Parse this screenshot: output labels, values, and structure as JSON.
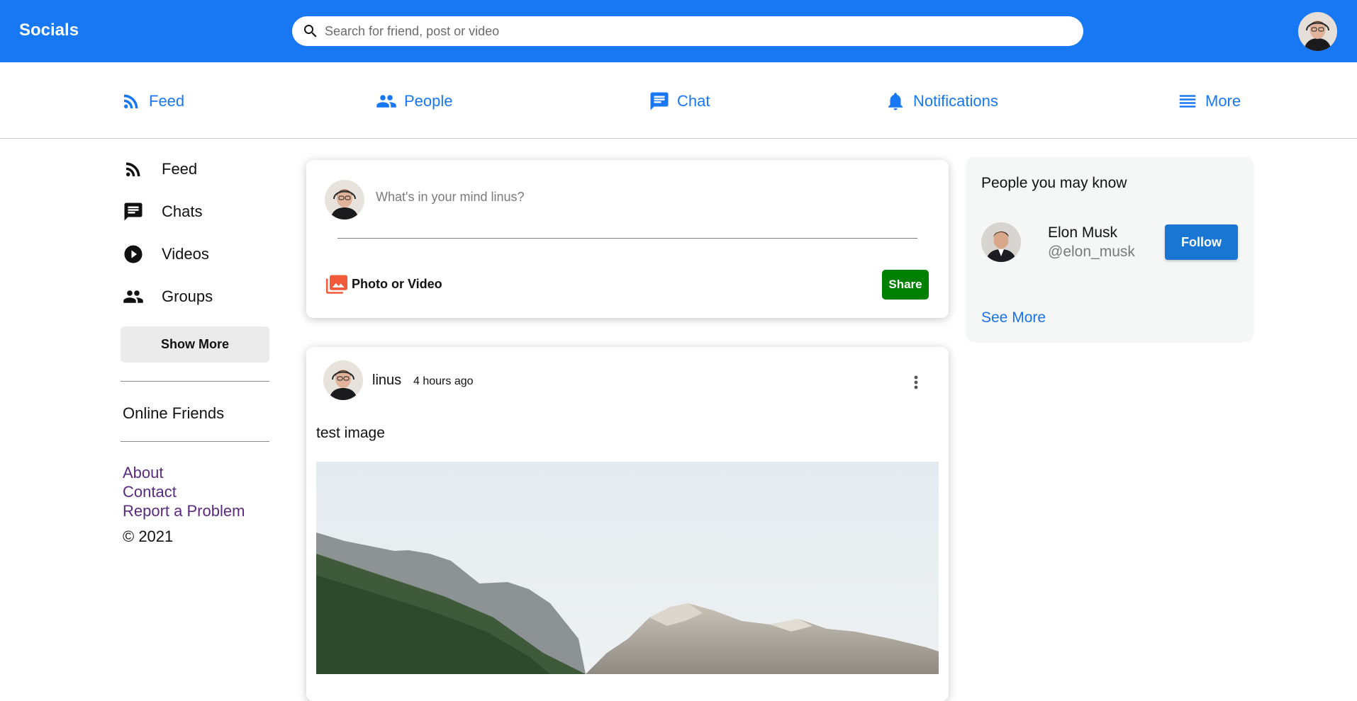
{
  "app": {
    "title": "Socials"
  },
  "search": {
    "placeholder": "Search for friend, post or video"
  },
  "nav": {
    "items": [
      {
        "label": "Feed",
        "icon": "rss-icon"
      },
      {
        "label": "People",
        "icon": "people-icon"
      },
      {
        "label": "Chat",
        "icon": "chat-icon"
      },
      {
        "label": "Notifications",
        "icon": "bell-icon"
      },
      {
        "label": "More",
        "icon": "menu-icon"
      }
    ]
  },
  "sidebar": {
    "items": [
      {
        "label": "Feed",
        "icon": "rss-icon"
      },
      {
        "label": "Chats",
        "icon": "chat-icon"
      },
      {
        "label": "Videos",
        "icon": "play-circle-icon"
      },
      {
        "label": "Groups",
        "icon": "group-icon"
      }
    ],
    "show_more": "Show More",
    "online_friends": "Online Friends",
    "links": [
      "About",
      "Contact",
      "Report a Problem"
    ],
    "copyright": "© 2021"
  },
  "share": {
    "placeholder": "What's in your mind linus?",
    "photo_label": "Photo or Video",
    "share_button": "Share"
  },
  "post": {
    "username": "linus",
    "time": "4 hours ago",
    "text": "test image"
  },
  "suggestions": {
    "title": "People you may know",
    "person": {
      "name": "Elon Musk",
      "handle": "@elon_musk"
    },
    "follow_button": "Follow",
    "see_more": "See More"
  },
  "colors": {
    "brand": "#1877f2",
    "share_button": "#008000",
    "follow_button": "#1976d2",
    "link_visited": "#5a2a82"
  }
}
